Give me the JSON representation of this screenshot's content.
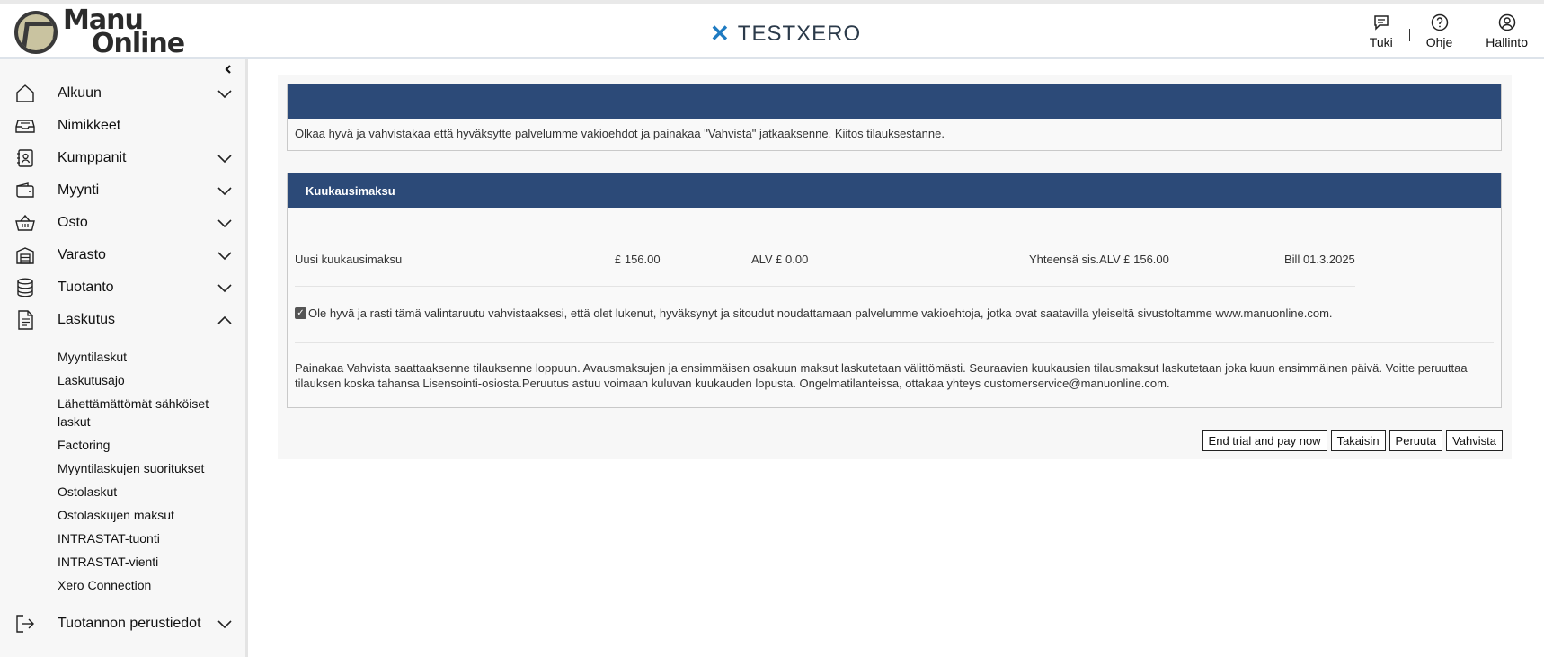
{
  "header": {
    "logo_line1": "Manu",
    "logo_line2": "Online",
    "brand": "TESTXERO",
    "actions": [
      {
        "label": "Tuki",
        "icon": "chat-icon"
      },
      {
        "label": "Ohje",
        "icon": "help-icon"
      },
      {
        "label": "Hallinto",
        "icon": "user-icon"
      }
    ]
  },
  "sidebar": {
    "items": [
      {
        "label": "Alkuun",
        "icon": "home-icon",
        "chevron": "down"
      },
      {
        "label": "Nimikkeet",
        "icon": "inbox-icon",
        "chevron": ""
      },
      {
        "label": "Kumppanit",
        "icon": "contacts-icon",
        "chevron": "down"
      },
      {
        "label": "Myynti",
        "icon": "wallet-icon",
        "chevron": "down"
      },
      {
        "label": "Osto",
        "icon": "basket-icon",
        "chevron": "down"
      },
      {
        "label": "Varasto",
        "icon": "warehouse-icon",
        "chevron": "down"
      },
      {
        "label": "Tuotanto",
        "icon": "database-icon",
        "chevron": "down"
      },
      {
        "label": "Laskutus",
        "icon": "document-icon",
        "chevron": "up"
      }
    ],
    "subitems": [
      "Myyntilaskut",
      "Laskutusajo",
      "Lähettämättömät sähköiset laskut",
      "Factoring",
      "Myyntilaskujen suoritukset",
      "Ostolaskut",
      "Ostolaskujen maksut",
      "INTRASTAT-tuonti",
      "INTRASTAT-vienti",
      "Xero Connection"
    ],
    "bottom_item": {
      "label": "Tuotannon perustiedot",
      "icon": "logout-icon",
      "chevron": "down"
    }
  },
  "main": {
    "notice": "Olkaa hyvä ja vahvistakaa että hyväksytte palvelumme vakioehdot ja painakaa \"Vahvista\" jatkaaksenne. Kiitos tilauksestanne.",
    "fee_title": "Kuukausimaksu",
    "fee_row": {
      "label": "Uusi kuukausimaksu",
      "amount": "£ 156.00",
      "vat": "ALV £ 0.00",
      "total": "Yhteensä sis.ALV £ 156.00",
      "bill": "Bill 01.3.2025"
    },
    "terms_checkbox": "Ole hyvä ja rasti tämä valintaruutu vahvistaaksesi, että olet lukenut, hyväksynyt ja sitoudut noudattamaan palvelumme vakioehtoja, jotka ovat saatavilla yleiseltä sivustoltamme www.manuonline.com.",
    "terms_checked": true,
    "info_text": "Painakaa Vahvista saattaaksenne tilauksenne loppuun. Avausmaksujen ja ensimmäisen osakuun maksut laskutetaan välittömästi. Seuraavien kuukausien tilausmaksut laskutetaan joka kuun ensimmäinen päivä. Voitte peruuttaa tilauksen koska tahansa Lisensointi-osiosta.Peruutus astuu voimaan kuluvan kuukauden lopusta. Ongelmatilanteissa, ottakaa yhteys customerservice@manuonline.com.",
    "buttons": {
      "end_trial": "End trial and pay now",
      "back": "Takaisin",
      "cancel": "Peruuta",
      "confirm": "Vahvista"
    }
  }
}
